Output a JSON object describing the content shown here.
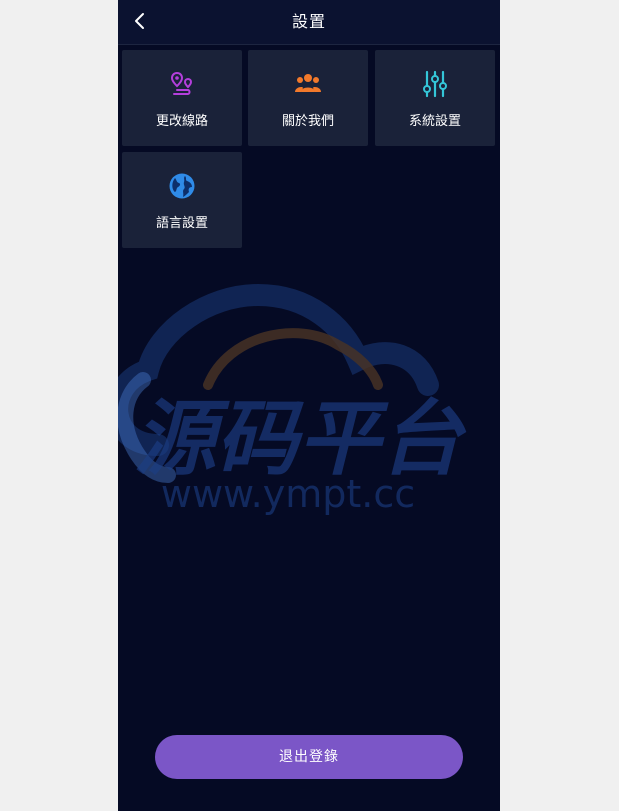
{
  "header": {
    "title": "設置",
    "back_icon": "chevron-left-icon"
  },
  "tiles": [
    {
      "label": "更改線路",
      "icon": "route-pin-icon",
      "color": "#b43fdc"
    },
    {
      "label": "關於我們",
      "icon": "users-group-icon",
      "color": "#f2792b"
    },
    {
      "label": "系統設置",
      "icon": "sliders-icon",
      "color": "#34c6d8"
    },
    {
      "label": "語言設置",
      "icon": "globe-icon",
      "color": "#2f8be8"
    }
  ],
  "watermark": {
    "title": "源码平台",
    "url": "www.ympt.cc"
  },
  "logout": {
    "label": "退出登錄",
    "color": "#7b56c7"
  }
}
